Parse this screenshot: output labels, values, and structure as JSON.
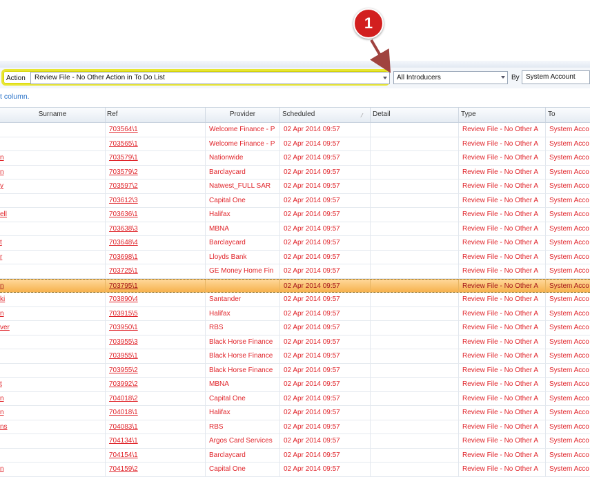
{
  "callout": {
    "number": "1"
  },
  "filters": {
    "action_label": "Action",
    "action_value": "Review File - No Other Action in To Do List",
    "introducer_value": "All Introducers",
    "by_label": "By",
    "account_value": "System Account"
  },
  "hint_text": "t column.",
  "columns": {
    "surname": "Surname",
    "ref": "Ref",
    "provider": "Provider",
    "scheduled": "Scheduled",
    "detail": "Detail",
    "type": "Type",
    "to": "To"
  },
  "rows": [
    {
      "surname": "",
      "ref": "703564\\1",
      "provider": "Welcome Finance - P",
      "scheduled": "02 Apr 2014 09:57",
      "detail": "",
      "type": "Review File - No Other A",
      "to": "System Acco"
    },
    {
      "surname": "",
      "ref": "703565\\1",
      "provider": "Welcome Finance - P",
      "scheduled": "02 Apr 2014 09:57",
      "detail": "",
      "type": "Review File - No Other A",
      "to": "System Acco"
    },
    {
      "surname": "n",
      "ref": "703579\\1",
      "provider": "Nationwide",
      "scheduled": "02 Apr 2014 09:57",
      "detail": "",
      "type": "Review File - No Other A",
      "to": "System Acco"
    },
    {
      "surname": "n",
      "ref": "703579\\2",
      "provider": "Barclaycard",
      "scheduled": "02 Apr 2014 09:57",
      "detail": "",
      "type": "Review File - No Other A",
      "to": "System Acco"
    },
    {
      "surname": "y",
      "ref": "703597\\2",
      "provider": "Natwest_FULL SAR",
      "scheduled": "02 Apr 2014 09:57",
      "detail": "",
      "type": "Review File - No Other A",
      "to": "System Acco"
    },
    {
      "surname": "",
      "ref": "703612\\3",
      "provider": "Capital One",
      "scheduled": "02 Apr 2014 09:57",
      "detail": "",
      "type": "Review File - No Other A",
      "to": "System Acco"
    },
    {
      "surname": "ell",
      "ref": "703636\\1",
      "provider": "Halifax",
      "scheduled": "02 Apr 2014 09:57",
      "detail": "",
      "type": "Review File - No Other A",
      "to": "System Acco"
    },
    {
      "surname": "",
      "ref": "703638\\3",
      "provider": "MBNA",
      "scheduled": "02 Apr 2014 09:57",
      "detail": "",
      "type": "Review File - No Other A",
      "to": "System Acco"
    },
    {
      "surname": "t",
      "ref": "703648\\4",
      "provider": "Barclaycard",
      "scheduled": "02 Apr 2014 09:57",
      "detail": "",
      "type": "Review File - No Other A",
      "to": "System Acco"
    },
    {
      "surname": "r",
      "ref": "703698\\1",
      "provider": "Lloyds Bank",
      "scheduled": "02 Apr 2014 09:57",
      "detail": "",
      "type": "Review File - No Other A",
      "to": "System Acco"
    },
    {
      "surname": "",
      "ref": "703725\\1",
      "provider": "GE Money Home Fin",
      "scheduled": "02 Apr 2014 09:57",
      "detail": "",
      "type": "Review File - No Other A",
      "to": "System Acco"
    },
    {
      "surname": "n",
      "ref": "703795\\1",
      "provider": "",
      "scheduled": "02 Apr 2014 09:57",
      "detail": "",
      "type": "Review File - No Other A",
      "to": "System Acco",
      "selected": true
    },
    {
      "surname": "ki",
      "ref": "703890\\4",
      "provider": "Santander",
      "scheduled": "02 Apr 2014 09:57",
      "detail": "",
      "type": "Review File - No Other A",
      "to": "System Acco"
    },
    {
      "surname": "n",
      "ref": "703915\\5",
      "provider": "Halifax",
      "scheduled": "02 Apr 2014 09:57",
      "detail": "",
      "type": "Review File - No Other A",
      "to": "System Acco"
    },
    {
      "surname": "ver",
      "ref": "703950\\1",
      "provider": "RBS",
      "scheduled": "02 Apr 2014 09:57",
      "detail": "",
      "type": "Review File - No Other A",
      "to": "System Acco"
    },
    {
      "surname": "",
      "ref": "703955\\3",
      "provider": "Black Horse Finance",
      "scheduled": "02 Apr 2014 09:57",
      "detail": "",
      "type": "Review File - No Other A",
      "to": "System Acco"
    },
    {
      "surname": "",
      "ref": "703955\\1",
      "provider": "Black Horse Finance",
      "scheduled": "02 Apr 2014 09:57",
      "detail": "",
      "type": "Review File - No Other A",
      "to": "System Acco"
    },
    {
      "surname": "",
      "ref": "703955\\2",
      "provider": "Black Horse Finance",
      "scheduled": "02 Apr 2014 09:57",
      "detail": "",
      "type": "Review File - No Other A",
      "to": "System Acco"
    },
    {
      "surname": "t",
      "ref": "703992\\2",
      "provider": "MBNA",
      "scheduled": "02 Apr 2014 09:57",
      "detail": "",
      "type": "Review File - No Other A",
      "to": "System Acco"
    },
    {
      "surname": "n",
      "ref": "704018\\2",
      "provider": "Capital One",
      "scheduled": "02 Apr 2014 09:57",
      "detail": "",
      "type": "Review File - No Other A",
      "to": "System Acco"
    },
    {
      "surname": "n",
      "ref": "704018\\1",
      "provider": "Halifax",
      "scheduled": "02 Apr 2014 09:57",
      "detail": "",
      "type": "Review File - No Other A",
      "to": "System Acco"
    },
    {
      "surname": "ns",
      "ref": "704083\\1",
      "provider": "RBS",
      "scheduled": "02 Apr 2014 09:57",
      "detail": "",
      "type": "Review File - No Other A",
      "to": "System Acco"
    },
    {
      "surname": "",
      "ref": "704134\\1",
      "provider": "Argos Card Services",
      "scheduled": "02 Apr 2014 09:57",
      "detail": "",
      "type": "Review File - No Other A",
      "to": "System Acco"
    },
    {
      "surname": "",
      "ref": "704154\\1",
      "provider": "Barclaycard",
      "scheduled": "02 Apr 2014 09:57",
      "detail": "",
      "type": "Review File - No Other A",
      "to": "System Acco"
    },
    {
      "surname": "n",
      "ref": "704159\\2",
      "provider": "Capital One",
      "scheduled": "02 Apr 2014 09:57",
      "detail": "",
      "type": "Review File - No Other A",
      "to": "System Acco"
    }
  ]
}
